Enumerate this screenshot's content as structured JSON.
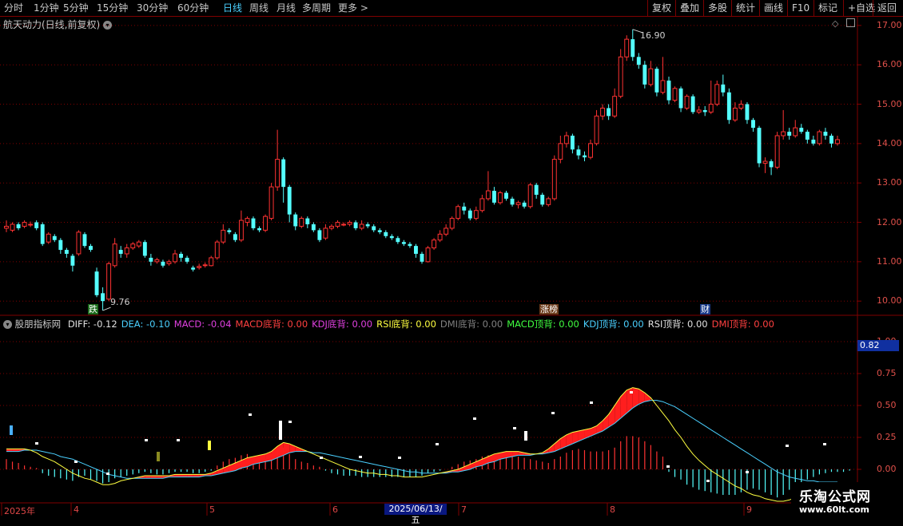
{
  "toolbar": {
    "periods": [
      "分时",
      "1分钟",
      "5分钟",
      "15分钟",
      "30分钟",
      "60分钟",
      "日线",
      "周线",
      "月线",
      "多周期",
      "更多 >"
    ],
    "active_period": "日线",
    "tools": [
      "复权",
      "叠加",
      "多股",
      "统计",
      "画线",
      "F10",
      "标记",
      "+自选",
      "返回"
    ]
  },
  "stock": {
    "title": "航天动力(日线,前复权)"
  },
  "price_axis": {
    "labels": [
      "17.00",
      "16.00",
      "15.00",
      "14.00",
      "13.00",
      "12.00",
      "11.00",
      "10.00"
    ]
  },
  "price_annotations": {
    "high": "16.90",
    "low": "9.76"
  },
  "event_tags": [
    {
      "text": "跌",
      "bg": "#1a6b1a",
      "color": "#ffffff"
    },
    {
      "text": "涨榜",
      "bg": "#6b3a1a",
      "color": "#ffffff"
    },
    {
      "text": "财",
      "bg": "#1a3a8a",
      "color": "#ffffff"
    }
  ],
  "indicator": {
    "name": "股朋指标网",
    "items": [
      {
        "label": "DIFF:",
        "value": "-0.12",
        "color": "#e0e0e0"
      },
      {
        "label": "DEA:",
        "value": "-0.10",
        "color": "#4ad0ff"
      },
      {
        "label": "MACD:",
        "value": "-0.04",
        "color": "#e040e0"
      },
      {
        "label": "MACD底背:",
        "value": "0.00",
        "color": "#ff4040"
      },
      {
        "label": "KDJ底背:",
        "value": "0.00",
        "color": "#e040e0"
      },
      {
        "label": "RSI底背:",
        "value": "0.00",
        "color": "#ffff40"
      },
      {
        "label": "DMI底背:",
        "value": "0.00",
        "color": "#808080"
      },
      {
        "label": "MACD顶背:",
        "value": "0.00",
        "color": "#40ff40"
      },
      {
        "label": "KDJ顶背:",
        "value": "0.00",
        "color": "#4ad0ff"
      },
      {
        "label": "RSI顶背:",
        "value": "0.00",
        "color": "#e0e0e0"
      },
      {
        "label": "DMI顶背:",
        "value": "0.00",
        "color": "#ff4040"
      }
    ]
  },
  "indicator_axis": {
    "labels": [
      "1.00",
      "0.75",
      "0.50",
      "0.25",
      "0.00"
    ],
    "current": "0.82"
  },
  "time_axis": {
    "labels": [
      "2025年",
      "4",
      "5",
      "6",
      "7",
      "8",
      "9"
    ],
    "cursor_date": "2025/06/13/五"
  },
  "watermark": {
    "title": "乐淘公式网",
    "url": "www.60lt.com"
  },
  "colors": {
    "up": "#ff3232",
    "down": "#54ffff",
    "grid": "#800000",
    "axis_text": "#e0504a"
  },
  "chart_data": {
    "type": "candlestick",
    "price_range": [
      9.7,
      17.2
    ],
    "high": 16.9,
    "low": 9.76,
    "candles": [
      [
        11.85,
        11.9,
        11.75,
        12.05
      ],
      [
        11.8,
        11.95,
        11.75,
        12.0
      ],
      [
        11.95,
        11.85,
        11.8,
        12.0
      ],
      [
        11.9,
        12.0,
        11.85,
        12.05
      ],
      [
        11.95,
        11.95,
        11.88,
        12.02
      ],
      [
        12.0,
        11.85,
        11.8,
        12.05
      ],
      [
        11.95,
        11.45,
        11.4,
        12.0
      ],
      [
        11.5,
        11.7,
        11.45,
        11.75
      ],
      [
        11.65,
        11.55,
        11.5,
        11.7
      ],
      [
        11.55,
        11.3,
        11.2,
        11.6
      ],
      [
        11.3,
        11.2,
        11.1,
        11.35
      ],
      [
        11.15,
        10.9,
        10.75,
        11.2
      ],
      [
        11.2,
        11.75,
        11.15,
        11.8
      ],
      [
        11.7,
        11.4,
        11.35,
        11.75
      ],
      [
        11.4,
        11.3,
        11.25,
        11.45
      ],
      [
        10.75,
        10.15,
        10.1,
        10.85
      ],
      [
        10.2,
        10.0,
        9.76,
        10.35
      ],
      [
        10.05,
        10.95,
        10.0,
        11.0
      ],
      [
        10.9,
        11.45,
        10.85,
        11.6
      ],
      [
        11.3,
        11.2,
        11.1,
        11.4
      ],
      [
        11.2,
        11.35,
        11.1,
        11.45
      ],
      [
        11.35,
        11.45,
        11.3,
        11.5
      ],
      [
        11.4,
        11.5,
        11.35,
        11.55
      ],
      [
        11.5,
        11.15,
        11.1,
        11.55
      ],
      [
        11.1,
        11.0,
        10.9,
        11.2
      ],
      [
        11.0,
        11.05,
        10.95,
        11.1
      ],
      [
        11.0,
        10.9,
        10.85,
        11.05
      ],
      [
        10.95,
        11.0,
        10.9,
        11.05
      ],
      [
        11.0,
        11.2,
        10.95,
        11.3
      ],
      [
        11.2,
        11.1,
        11.0,
        11.25
      ],
      [
        11.1,
        11.0,
        10.95,
        11.15
      ],
      [
        10.85,
        10.8,
        10.75,
        10.9
      ],
      [
        10.85,
        10.88,
        10.8,
        10.95
      ],
      [
        10.9,
        10.92,
        10.85,
        10.98
      ],
      [
        10.9,
        11.1,
        10.88,
        11.15
      ],
      [
        11.1,
        11.5,
        11.05,
        11.55
      ],
      [
        11.5,
        11.8,
        11.45,
        11.95
      ],
      [
        11.8,
        11.75,
        11.7,
        11.85
      ],
      [
        11.7,
        11.55,
        11.5,
        11.75
      ],
      [
        11.55,
        12.05,
        11.5,
        12.3
      ],
      [
        12.0,
        12.1,
        11.9,
        12.15
      ],
      [
        12.1,
        11.85,
        11.8,
        12.15
      ],
      [
        11.85,
        11.8,
        11.75,
        11.9
      ],
      [
        11.8,
        12.15,
        11.75,
        12.2
      ],
      [
        12.1,
        12.9,
        12.05,
        13.0
      ],
      [
        12.9,
        13.6,
        12.8,
        14.35
      ],
      [
        13.6,
        12.9,
        12.5,
        13.65
      ],
      [
        12.9,
        12.2,
        12.0,
        12.95
      ],
      [
        12.2,
        11.9,
        11.8,
        12.25
      ],
      [
        11.9,
        12.1,
        11.85,
        12.15
      ],
      [
        12.1,
        11.95,
        11.85,
        12.15
      ],
      [
        11.95,
        11.8,
        11.75,
        12.0
      ],
      [
        11.8,
        11.55,
        11.5,
        11.85
      ],
      [
        11.6,
        11.85,
        11.55,
        11.95
      ],
      [
        11.85,
        11.9,
        11.8,
        11.95
      ],
      [
        11.9,
        12.0,
        11.85,
        12.05
      ],
      [
        11.95,
        11.95,
        11.9,
        12.0
      ],
      [
        11.95,
        12.0,
        11.9,
        12.05
      ],
      [
        12.0,
        11.85,
        11.8,
        12.05
      ],
      [
        11.85,
        11.95,
        11.8,
        12.05
      ],
      [
        11.95,
        11.9,
        11.85,
        12.0
      ],
      [
        11.9,
        11.8,
        11.75,
        11.95
      ],
      [
        11.8,
        11.75,
        11.7,
        11.85
      ],
      [
        11.75,
        11.65,
        11.6,
        11.8
      ],
      [
        11.65,
        11.6,
        11.55,
        11.7
      ],
      [
        11.6,
        11.5,
        11.45,
        11.65
      ],
      [
        11.5,
        11.45,
        11.4,
        11.55
      ],
      [
        11.45,
        11.4,
        11.35,
        11.5
      ],
      [
        11.4,
        11.2,
        11.1,
        11.45
      ],
      [
        11.2,
        11.0,
        10.95,
        11.25
      ],
      [
        11.0,
        11.35,
        10.98,
        11.4
      ],
      [
        11.35,
        11.55,
        11.3,
        11.6
      ],
      [
        11.55,
        11.7,
        11.5,
        11.8
      ],
      [
        11.7,
        11.85,
        11.65,
        11.95
      ],
      [
        11.85,
        12.1,
        11.8,
        12.15
      ],
      [
        12.1,
        12.4,
        12.05,
        12.45
      ],
      [
        12.4,
        12.3,
        12.2,
        12.5
      ],
      [
        12.3,
        12.1,
        12.05,
        12.35
      ],
      [
        12.1,
        12.3,
        12.05,
        12.4
      ],
      [
        12.3,
        12.6,
        12.25,
        12.7
      ],
      [
        12.6,
        12.8,
        12.55,
        13.3
      ],
      [
        12.8,
        12.5,
        12.45,
        12.9
      ],
      [
        12.5,
        12.75,
        12.45,
        12.8
      ],
      [
        12.75,
        12.6,
        12.55,
        12.8
      ],
      [
        12.6,
        12.45,
        12.4,
        12.65
      ],
      [
        12.45,
        12.5,
        12.35,
        12.55
      ],
      [
        12.5,
        12.4,
        12.35,
        12.55
      ],
      [
        12.4,
        12.95,
        12.35,
        13.0
      ],
      [
        12.95,
        12.7,
        12.6,
        13.0
      ],
      [
        12.7,
        12.45,
        12.4,
        12.75
      ],
      [
        12.45,
        12.6,
        12.4,
        12.65
      ],
      [
        12.6,
        13.6,
        12.55,
        13.7
      ],
      [
        13.6,
        14.0,
        13.5,
        14.2
      ],
      [
        14.0,
        14.2,
        13.9,
        14.3
      ],
      [
        14.2,
        13.85,
        13.75,
        14.25
      ],
      [
        13.85,
        13.7,
        13.6,
        13.95
      ],
      [
        13.7,
        13.65,
        13.55,
        13.8
      ],
      [
        13.65,
        14.0,
        13.6,
        14.1
      ],
      [
        14.0,
        14.7,
        13.95,
        14.85
      ],
      [
        14.7,
        14.9,
        14.6,
        15.0
      ],
      [
        14.9,
        14.7,
        14.6,
        15.0
      ],
      [
        14.7,
        15.2,
        14.65,
        15.4
      ],
      [
        15.2,
        16.2,
        15.15,
        16.4
      ],
      [
        16.2,
        16.65,
        16.1,
        16.75
      ],
      [
        16.65,
        16.2,
        16.1,
        16.9
      ],
      [
        16.2,
        16.0,
        15.9,
        16.3
      ],
      [
        16.0,
        15.5,
        15.4,
        16.1
      ],
      [
        15.5,
        15.9,
        15.45,
        16.1
      ],
      [
        15.9,
        15.3,
        15.2,
        15.95
      ],
      [
        15.3,
        15.6,
        15.25,
        16.2
      ],
      [
        15.6,
        15.1,
        15.0,
        15.7
      ],
      [
        15.1,
        15.4,
        15.05,
        15.45
      ],
      [
        15.4,
        14.9,
        14.8,
        15.45
      ],
      [
        14.9,
        15.2,
        14.85,
        15.25
      ],
      [
        15.2,
        14.8,
        14.75,
        15.25
      ],
      [
        14.8,
        14.85,
        14.75,
        14.95
      ],
      [
        14.85,
        14.8,
        14.7,
        14.95
      ],
      [
        14.8,
        15.0,
        14.75,
        15.6
      ],
      [
        15.0,
        15.5,
        14.95,
        15.6
      ],
      [
        15.5,
        15.3,
        15.2,
        15.75
      ],
      [
        15.3,
        14.6,
        14.5,
        15.4
      ],
      [
        14.6,
        14.9,
        14.55,
        15.05
      ],
      [
        14.9,
        15.0,
        14.85,
        15.1
      ],
      [
        15.0,
        14.6,
        14.5,
        15.05
      ],
      [
        14.6,
        14.4,
        14.3,
        14.65
      ],
      [
        14.4,
        13.5,
        13.4,
        14.45
      ],
      [
        13.5,
        13.55,
        13.25,
        13.65
      ],
      [
        13.55,
        13.4,
        13.2,
        13.6
      ],
      [
        13.4,
        14.2,
        13.35,
        14.3
      ],
      [
        14.2,
        14.3,
        14.1,
        14.85
      ],
      [
        14.3,
        14.2,
        14.1,
        14.4
      ],
      [
        14.2,
        14.4,
        14.15,
        14.6
      ],
      [
        14.4,
        14.3,
        14.25,
        14.5
      ],
      [
        14.3,
        14.1,
        14.0,
        14.35
      ],
      [
        14.1,
        14.0,
        13.95,
        14.2
      ],
      [
        14.0,
        14.3,
        13.95,
        14.35
      ],
      [
        14.3,
        14.2,
        14.1,
        14.4
      ],
      [
        14.2,
        14.0,
        13.9,
        14.25
      ],
      [
        14.0,
        14.1,
        13.95,
        14.2
      ]
    ],
    "indicator_range": [
      -0.25,
      1.1
    ],
    "indicator_bars": [
      0.08,
      0.06,
      0.05,
      0.03,
      0.02,
      0.01,
      -0.03,
      -0.05,
      -0.06,
      -0.07,
      -0.08,
      -0.09,
      -0.06,
      -0.05,
      -0.08,
      -0.09,
      -0.11,
      -0.1,
      -0.07,
      -0.06,
      -0.05,
      -0.04,
      -0.03,
      -0.02,
      -0.03,
      -0.04,
      -0.04,
      -0.03,
      -0.02,
      -0.02,
      -0.02,
      -0.03,
      -0.03,
      -0.02,
      -0.01,
      0.03,
      0.06,
      0.08,
      0.09,
      0.11,
      0.12,
      0.1,
      0.09,
      0.08,
      0.12,
      0.18,
      0.17,
      0.12,
      0.08,
      0.06,
      0.05,
      0.03,
      0.02,
      -0.01,
      -0.03,
      -0.04,
      -0.05,
      -0.05,
      -0.05,
      -0.06,
      -0.06,
      -0.06,
      -0.06,
      -0.06,
      -0.06,
      -0.06,
      -0.06,
      -0.06,
      -0.06,
      -0.05,
      -0.03,
      -0.02,
      -0.01,
      0.0,
      0.02,
      0.04,
      0.06,
      0.07,
      0.08,
      0.1,
      0.11,
      0.12,
      0.12,
      0.12,
      0.11,
      0.1,
      0.09,
      0.08,
      0.07,
      0.06,
      0.05,
      0.08,
      0.1,
      0.13,
      0.15,
      0.16,
      0.15,
      0.14,
      0.14,
      0.14,
      0.15,
      0.17,
      0.22,
      0.26,
      0.26,
      0.25,
      0.22,
      0.19,
      0.14,
      0.1,
      -0.02,
      -0.06,
      -0.08,
      -0.12,
      -0.14,
      -0.16,
      -0.17,
      -0.18,
      -0.19,
      -0.2,
      -0.2,
      -0.2,
      -0.18,
      -0.16,
      -0.15,
      -0.16,
      -0.18,
      -0.2,
      -0.22,
      -0.2,
      -0.16,
      -0.12,
      -0.1,
      -0.08,
      -0.06,
      -0.04,
      -0.03,
      -0.02,
      -0.02,
      -0.02,
      -0.01
    ],
    "diff": [
      0.16,
      0.16,
      0.16,
      0.16,
      0.15,
      0.13,
      0.1,
      0.08,
      0.06,
      0.03,
      0.0,
      -0.03,
      -0.05,
      -0.07,
      -0.08,
      -0.1,
      -0.12,
      -0.12,
      -0.11,
      -0.09,
      -0.08,
      -0.07,
      -0.06,
      -0.05,
      -0.05,
      -0.05,
      -0.05,
      -0.05,
      -0.04,
      -0.04,
      -0.04,
      -0.04,
      -0.04,
      -0.04,
      -0.03,
      -0.01,
      0.01,
      0.03,
      0.05,
      0.07,
      0.09,
      0.1,
      0.11,
      0.12,
      0.14,
      0.18,
      0.21,
      0.2,
      0.18,
      0.16,
      0.14,
      0.12,
      0.1,
      0.08,
      0.06,
      0.04,
      0.02,
      0.0,
      -0.01,
      -0.02,
      -0.03,
      -0.03,
      -0.04,
      -0.04,
      -0.05,
      -0.05,
      -0.06,
      -0.06,
      -0.06,
      -0.06,
      -0.05,
      -0.04,
      -0.03,
      -0.02,
      -0.01,
      0.0,
      0.02,
      0.04,
      0.06,
      0.08,
      0.1,
      0.12,
      0.13,
      0.14,
      0.14,
      0.14,
      0.13,
      0.12,
      0.12,
      0.13,
      0.16,
      0.2,
      0.24,
      0.27,
      0.29,
      0.3,
      0.31,
      0.32,
      0.34,
      0.38,
      0.43,
      0.5,
      0.57,
      0.62,
      0.64,
      0.63,
      0.6,
      0.56,
      0.5,
      0.44,
      0.38,
      0.31,
      0.25,
      0.18,
      0.12,
      0.07,
      0.03,
      -0.01,
      -0.04,
      -0.07,
      -0.1,
      -0.13,
      -0.15,
      -0.18,
      -0.2,
      -0.21,
      -0.23,
      -0.24,
      -0.25,
      -0.25,
      -0.24,
      -0.22,
      -0.19,
      -0.16,
      -0.14,
      -0.13,
      -0.12,
      -0.12,
      -0.12,
      -0.12,
      -0.12,
      -0.12,
      -0.12
    ],
    "dea": [
      0.14,
      0.14,
      0.14,
      0.15,
      0.15,
      0.15,
      0.14,
      0.13,
      0.12,
      0.1,
      0.09,
      0.08,
      0.06,
      0.04,
      0.02,
      0.0,
      -0.02,
      -0.04,
      -0.05,
      -0.06,
      -0.07,
      -0.07,
      -0.07,
      -0.07,
      -0.07,
      -0.07,
      -0.07,
      -0.06,
      -0.06,
      -0.06,
      -0.06,
      -0.06,
      -0.06,
      -0.05,
      -0.05,
      -0.04,
      -0.03,
      -0.02,
      -0.01,
      0.01,
      0.02,
      0.04,
      0.05,
      0.06,
      0.07,
      0.09,
      0.11,
      0.13,
      0.14,
      0.14,
      0.14,
      0.13,
      0.13,
      0.12,
      0.11,
      0.1,
      0.09,
      0.08,
      0.07,
      0.06,
      0.05,
      0.04,
      0.03,
      0.02,
      0.01,
      0.0,
      -0.01,
      -0.02,
      -0.02,
      -0.03,
      -0.03,
      -0.03,
      -0.03,
      -0.03,
      -0.02,
      -0.02,
      -0.01,
      0.0,
      0.02,
      0.03,
      0.05,
      0.06,
      0.08,
      0.09,
      0.1,
      0.11,
      0.11,
      0.11,
      0.12,
      0.12,
      0.13,
      0.14,
      0.16,
      0.18,
      0.2,
      0.22,
      0.24,
      0.26,
      0.28,
      0.3,
      0.33,
      0.36,
      0.4,
      0.44,
      0.48,
      0.51,
      0.53,
      0.54,
      0.54,
      0.53,
      0.51,
      0.49,
      0.46,
      0.43,
      0.4,
      0.37,
      0.34,
      0.31,
      0.28,
      0.25,
      0.22,
      0.19,
      0.16,
      0.13,
      0.1,
      0.07,
      0.04,
      0.01,
      -0.02,
      -0.04,
      -0.06,
      -0.07,
      -0.08,
      -0.09,
      -0.09,
      -0.1,
      -0.1,
      -0.1,
      -0.1,
      -0.1,
      -0.1,
      -0.1
    ]
  }
}
